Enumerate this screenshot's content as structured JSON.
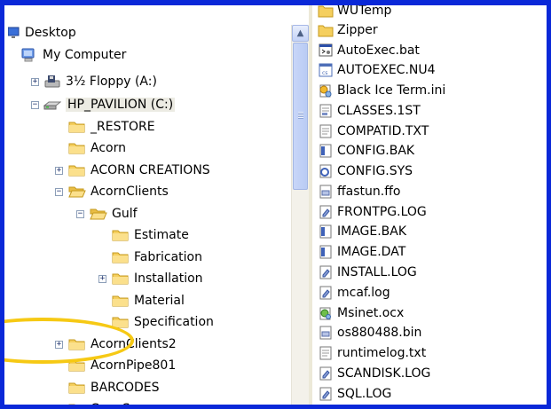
{
  "tree": {
    "items": [
      {
        "label": "Desktop",
        "icon": "desktop-icon"
      },
      {
        "label": "My Computer",
        "icon": "my-computer-icon"
      },
      {
        "label": "3½ Floppy (A:)",
        "icon": "floppy-drive-icon",
        "expander": "+"
      },
      {
        "label": "HP_PAVILION (C:)",
        "icon": "hard-drive-icon",
        "expander": "−",
        "selected": true
      },
      {
        "label": "_RESTORE",
        "icon": "folder-icon"
      },
      {
        "label": "Acorn",
        "icon": "folder-icon"
      },
      {
        "label": "ACORN CREATIONS",
        "icon": "folder-icon",
        "expander": "+"
      },
      {
        "label": "AcornClients",
        "icon": "folder-icon",
        "expander": "−"
      },
      {
        "label": "Gulf",
        "icon": "folder-icon",
        "expander": "−"
      },
      {
        "label": "Estimate",
        "icon": "folder-icon"
      },
      {
        "label": "Fabrication",
        "icon": "folder-icon"
      },
      {
        "label": "Installation",
        "icon": "folder-icon",
        "expander": "+"
      },
      {
        "label": "Material",
        "icon": "folder-icon"
      },
      {
        "label": "Specification",
        "icon": "folder-icon"
      },
      {
        "label": "AcornClients2",
        "icon": "folder-icon",
        "expander": "+"
      },
      {
        "label": "AcornPipe801",
        "icon": "folder-icon"
      },
      {
        "label": "BARCODES",
        "icon": "folder-icon"
      },
      {
        "label": "CanoScan",
        "icon": "folder-icon",
        "expander": "+"
      }
    ]
  },
  "files": {
    "items": [
      {
        "label": "WUTemp",
        "icon": "folder-icon"
      },
      {
        "label": "Zipper",
        "icon": "folder-icon"
      },
      {
        "label": "AutoExec.bat",
        "icon": "batch-file-icon"
      },
      {
        "label": "AUTOEXEC.NU4",
        "icon": "system-file-icon"
      },
      {
        "label": "Black Ice Term.ini",
        "icon": "ini-file-icon"
      },
      {
        "label": "CLASSES.1ST",
        "icon": "system-file-icon"
      },
      {
        "label": "COMPATID.TXT",
        "icon": "text-file-icon"
      },
      {
        "label": "CONFIG.BAK",
        "icon": "generic-file-icon"
      },
      {
        "label": "CONFIG.SYS",
        "icon": "config-file-icon"
      },
      {
        "label": "ffastun.ffo",
        "icon": "system-file-icon"
      },
      {
        "label": "FRONTPG.LOG",
        "icon": "log-file-icon"
      },
      {
        "label": "IMAGE.BAK",
        "icon": "generic-file-icon"
      },
      {
        "label": "IMAGE.DAT",
        "icon": "generic-file-icon"
      },
      {
        "label": "INSTALL.LOG",
        "icon": "log-file-icon"
      },
      {
        "label": "mcaf.log",
        "icon": "log-file-icon"
      },
      {
        "label": "Msinet.ocx",
        "icon": "ocx-file-icon"
      },
      {
        "label": "os880488.bin",
        "icon": "system-file-icon"
      },
      {
        "label": "runtimelog.txt",
        "icon": "text-file-icon"
      },
      {
        "label": "SCANDISK.LOG",
        "icon": "log-file-icon"
      },
      {
        "label": "SQL.LOG",
        "icon": "log-file-icon"
      }
    ]
  },
  "colors": {
    "window_border": "#0a28d8",
    "folder": "#f5cf5e",
    "highlight_annotation": "#f6c914"
  }
}
